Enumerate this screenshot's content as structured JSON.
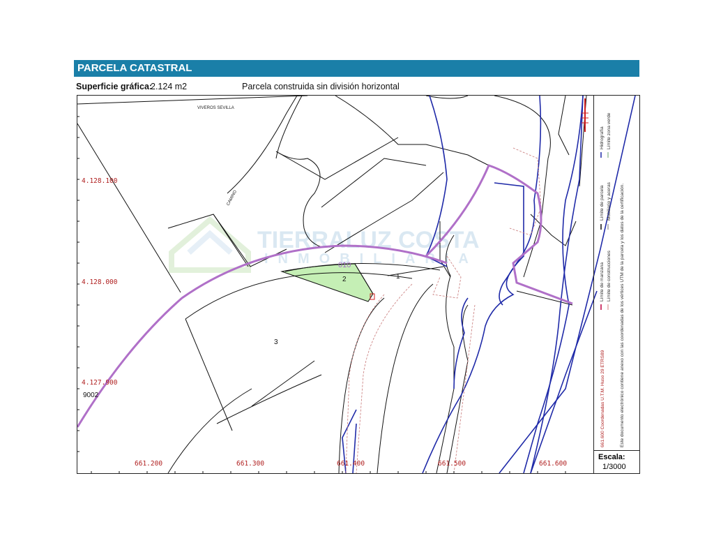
{
  "header": {
    "title_bold": "PARCELA",
    "title_rest": " CATASTRAL",
    "bar_color": "#1a7fa8"
  },
  "info": {
    "surface_label": "Superficie gráfica:",
    "surface_value": "2.124 m2",
    "description": "Parcela construida sin división horizontal"
  },
  "map": {
    "place_label": "VIVEROS SEVILLA",
    "road_label": "CAMINO",
    "y_coords": [
      "4.128.100",
      "4.128.000",
      "4.127.900"
    ],
    "x_coords": [
      "661.200",
      "661.300",
      "661.400",
      "661.500",
      "661.600"
    ],
    "side_number": "9002",
    "parcel_labels": [
      "1",
      "2",
      "3"
    ],
    "parcel_code": "010",
    "highlight_fill": "#c5efb5",
    "boundary_color": "#b070c8",
    "hydro_color": "#1f2aa8",
    "watermark_line1": "TIERRALUZ COSTA",
    "watermark_line2": "INMOBILIARIA"
  },
  "legend": {
    "col1": [
      "Límite de manzana",
      "Límite de construcciones"
    ],
    "col2": [
      "Límite de parcela",
      "Mobiliario y aceras"
    ],
    "col3": [
      "Hidrografía",
      "Límite zona verde"
    ],
    "coords_text": "661.600 Coordenadas U.T.M. Huso 29 ETRS89",
    "document_note": "Este documento electrónico contiene anexo con las coordenadas de los vértices UTM de la parcela y los datos de la certificación."
  },
  "scale": {
    "label": "Escala:",
    "value": "1/3000"
  }
}
